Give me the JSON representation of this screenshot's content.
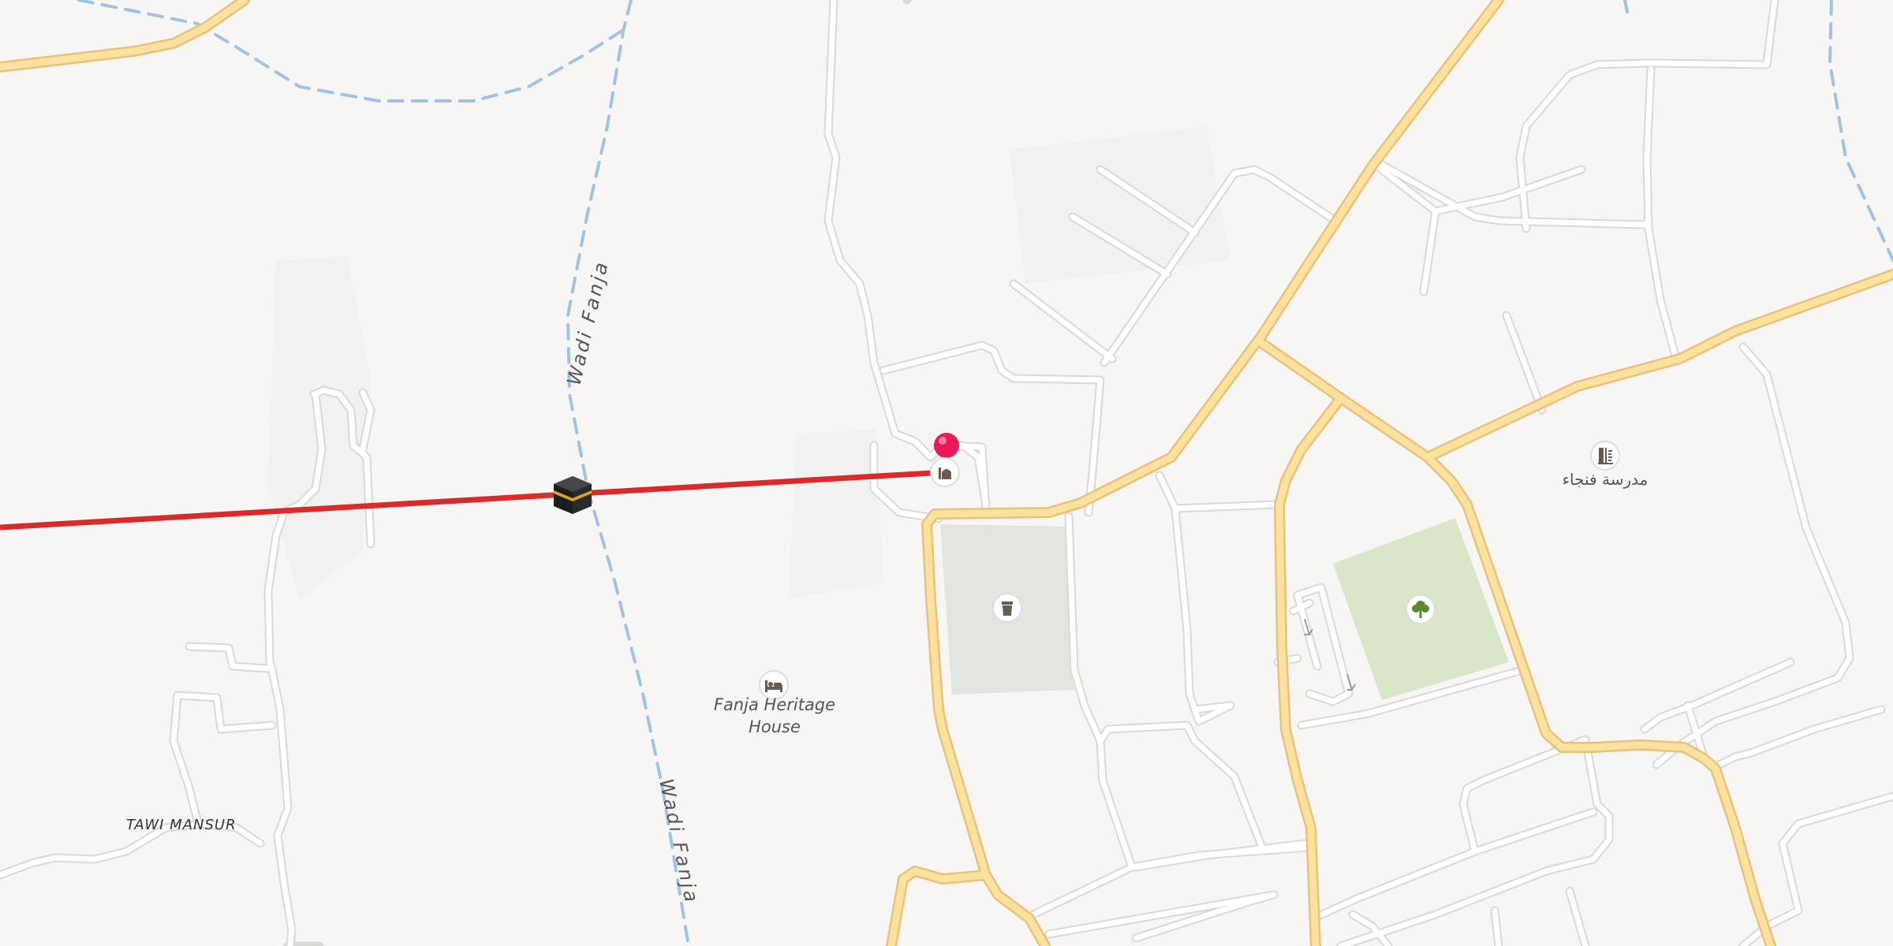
{
  "map": {
    "labels": {
      "waterway_1": "Wadi Fanja",
      "waterway_2": "Wadi Fanja",
      "hotel": "Fanja Heritage House",
      "hotel_line1": "Fanja Heritage",
      "hotel_line2": "House",
      "place": "TAWI MANSUR",
      "school": "مدرسة فنجاء"
    },
    "icons": {
      "kaaba": "kaaba-icon",
      "pin": "location-pin-icon",
      "mosque": "mosque-icon",
      "cemetery": "cemetery-icon",
      "hotel": "bed-icon",
      "park": "tree-icon",
      "school": "school-icon"
    },
    "colors": {
      "background": "#f8f6f4",
      "major_road": "#fde29f",
      "major_road_casing": "#e8c27a",
      "minor_road": "#ffffff",
      "minor_road_casing": "#dcd8d4",
      "water": "#9cc4ea",
      "qibla_line": "#d92b2b",
      "pin": "#e9195a",
      "cemetery": "#e2e4df",
      "park": "#d8e7c8"
    }
  }
}
